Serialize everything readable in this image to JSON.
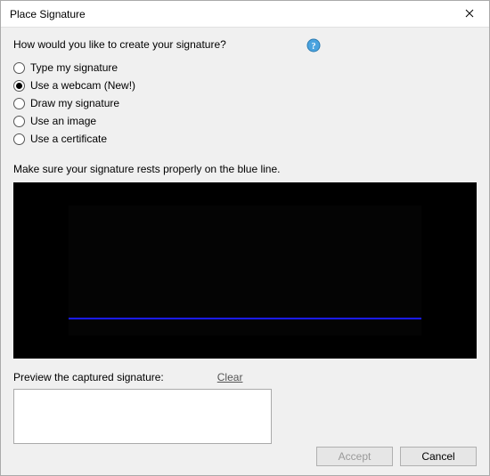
{
  "titlebar": {
    "title": "Place Signature"
  },
  "prompt": "How would you like to create your signature?",
  "options": [
    {
      "label": "Type my signature",
      "selected": false
    },
    {
      "label": "Use a webcam (New!)",
      "selected": true
    },
    {
      "label": "Draw my signature",
      "selected": false
    },
    {
      "label": "Use an image",
      "selected": false
    },
    {
      "label": "Use a certificate",
      "selected": false
    }
  ],
  "instruction": "Make sure your signature rests properly on the blue line.",
  "preview": {
    "label": "Preview the captured signature:",
    "clear": "Clear"
  },
  "buttons": {
    "accept": "Accept",
    "cancel": "Cancel"
  },
  "colors": {
    "blue_line": "#1a1aff"
  }
}
